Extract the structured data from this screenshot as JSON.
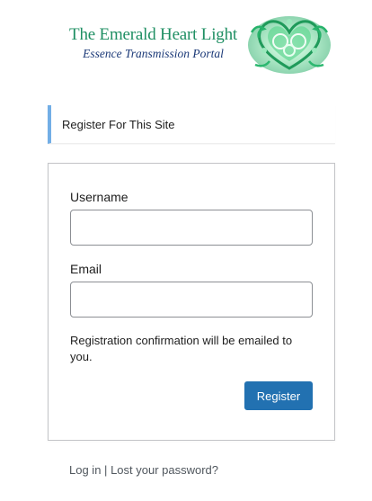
{
  "logo": {
    "title": "The Emerald Heart Light",
    "subtitle": "Essence Transmission Portal",
    "art_icon": "emerald-heart-swirl-icon",
    "colors": {
      "title": "#1f8f63",
      "subtitle": "#1c3a78",
      "art": "#2fc27a"
    }
  },
  "notice": {
    "text": "Register For This Site",
    "accent_color": "#72aee6"
  },
  "form": {
    "username_label": "Username",
    "username_value": "",
    "email_label": "Email",
    "email_value": "",
    "confirmation_note": "Registration confirmation will be emailed to you.",
    "submit_label": "Register",
    "submit_color": "#2271b1"
  },
  "nav": {
    "login_label": "Log in",
    "separator": "|",
    "lost_password_label": "Lost your password?"
  }
}
